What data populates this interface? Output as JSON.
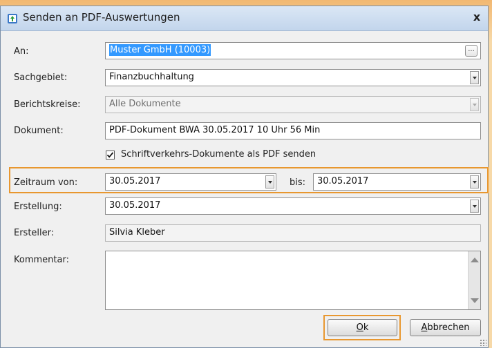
{
  "window": {
    "title": "Senden an PDF-Auswertungen",
    "close_label": "x"
  },
  "form": {
    "an": {
      "label": "An:",
      "value": "Muster GmbH (10003)",
      "browse_label": "..."
    },
    "sachgebiet": {
      "label": "Sachgebiet:",
      "value": "Finanzbuchhaltung"
    },
    "berichtskreise": {
      "label": "Berichtskreise:",
      "value": "Alle Dokumente"
    },
    "dokument": {
      "label": "Dokument:",
      "value": "PDF-Dokument BWA 30.05.2017 10 Uhr 56 Min"
    },
    "schriftverkehr": {
      "label": "Schriftverkehrs-Dokumente als PDF senden",
      "checked": true
    },
    "zeitraum": {
      "label": "Zeitraum von:",
      "from": "30.05.2017",
      "to_label": "bis:",
      "to": "30.05.2017"
    },
    "erstellung": {
      "label": "Erstellung:",
      "value": "30.05.2017"
    },
    "ersteller": {
      "label": "Ersteller:",
      "value": "Silvia Kleber"
    },
    "kommentar": {
      "label": "Kommentar:",
      "value": ""
    }
  },
  "buttons": {
    "ok": {
      "first": "O",
      "rest": "k"
    },
    "cancel": {
      "first": "A",
      "rest": "bbrechen"
    }
  },
  "colors": {
    "highlight": "#e8972f",
    "selection": "#3399ff",
    "titlebar": "#c2d5ec"
  }
}
